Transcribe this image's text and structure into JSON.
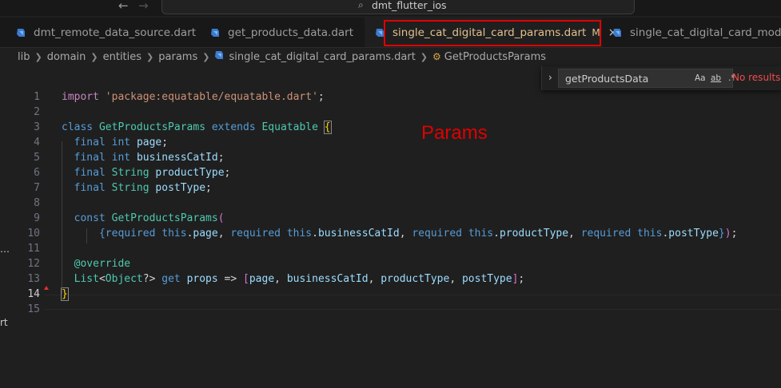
{
  "window": {
    "title": "dmt_flutter_ios"
  },
  "tabs": [
    {
      "label": "dmt_remote_data_source.dart"
    },
    {
      "label": "get_products_data.dart"
    },
    {
      "label": "single_cat_digital_card_params.dart",
      "modified": "M",
      "close": "×"
    },
    {
      "label": "single_cat_digital_card_model.d"
    }
  ],
  "breadcrumbs": {
    "parts": [
      "lib",
      "domain",
      "entities",
      "params",
      "single_cat_digital_card_params.dart"
    ],
    "symbol": "GetProductsParams"
  },
  "find": {
    "query": "getProductsData",
    "opt_case": "Aa",
    "opt_word": "ab",
    "opt_regex": ".*",
    "status": "No results"
  },
  "annotation": "Params",
  "left_fragments": [
    "…",
    "rt"
  ],
  "editor": {
    "current_line": 14,
    "lines": [
      {
        "n": "1",
        "tokens": [
          {
            "c": "kwc",
            "t": "import"
          },
          {
            "c": "plain",
            "t": " "
          },
          {
            "c": "str",
            "t": "'package:equatable/equatable.dart'"
          },
          {
            "c": "plain",
            "t": ";"
          }
        ]
      },
      {
        "n": "2",
        "tokens": []
      },
      {
        "n": "3",
        "tokens": [
          {
            "c": "kw",
            "t": "class"
          },
          {
            "c": "plain",
            "t": " "
          },
          {
            "c": "type",
            "t": "GetProductsParams"
          },
          {
            "c": "plain",
            "t": " "
          },
          {
            "c": "kw",
            "t": "extends"
          },
          {
            "c": "plain",
            "t": " "
          },
          {
            "c": "type",
            "t": "Equatable"
          },
          {
            "c": "plain",
            "t": " "
          },
          {
            "c": "b1 bracket-box",
            "t": "{"
          }
        ]
      },
      {
        "n": "4",
        "tokens": [
          {
            "c": "plain",
            "t": "  "
          },
          {
            "c": "kw",
            "t": "final"
          },
          {
            "c": "plain",
            "t": " "
          },
          {
            "c": "kw",
            "t": "int"
          },
          {
            "c": "plain",
            "t": " "
          },
          {
            "c": "var",
            "t": "page"
          },
          {
            "c": "plain",
            "t": ";"
          }
        ]
      },
      {
        "n": "5",
        "tokens": [
          {
            "c": "plain",
            "t": "  "
          },
          {
            "c": "kw",
            "t": "final"
          },
          {
            "c": "plain",
            "t": " "
          },
          {
            "c": "kw",
            "t": "int"
          },
          {
            "c": "plain",
            "t": " "
          },
          {
            "c": "var",
            "t": "businessCatId"
          },
          {
            "c": "plain",
            "t": ";"
          }
        ]
      },
      {
        "n": "6",
        "tokens": [
          {
            "c": "plain",
            "t": "  "
          },
          {
            "c": "kw",
            "t": "final"
          },
          {
            "c": "plain",
            "t": " "
          },
          {
            "c": "type",
            "t": "String"
          },
          {
            "c": "plain",
            "t": " "
          },
          {
            "c": "var",
            "t": "productType"
          },
          {
            "c": "plain",
            "t": ";"
          }
        ]
      },
      {
        "n": "7",
        "tokens": [
          {
            "c": "plain",
            "t": "  "
          },
          {
            "c": "kw",
            "t": "final"
          },
          {
            "c": "plain",
            "t": " "
          },
          {
            "c": "type",
            "t": "String"
          },
          {
            "c": "plain",
            "t": " "
          },
          {
            "c": "var",
            "t": "postType"
          },
          {
            "c": "plain",
            "t": ";"
          }
        ]
      },
      {
        "n": "8",
        "tokens": []
      },
      {
        "n": "9",
        "tokens": [
          {
            "c": "plain",
            "t": "  "
          },
          {
            "c": "kw",
            "t": "const"
          },
          {
            "c": "plain",
            "t": " "
          },
          {
            "c": "type",
            "t": "GetProductsParams"
          },
          {
            "c": "b2",
            "t": "("
          }
        ]
      },
      {
        "n": "10",
        "tokens": [
          {
            "c": "plain",
            "t": "      "
          },
          {
            "c": "kw",
            "t": "{"
          },
          {
            "c": "kw",
            "t": "required"
          },
          {
            "c": "plain",
            "t": " "
          },
          {
            "c": "kw",
            "t": "this"
          },
          {
            "c": "plain",
            "t": "."
          },
          {
            "c": "var",
            "t": "page"
          },
          {
            "c": "plain",
            "t": ", "
          },
          {
            "c": "kw",
            "t": "required"
          },
          {
            "c": "plain",
            "t": " "
          },
          {
            "c": "kw",
            "t": "this"
          },
          {
            "c": "plain",
            "t": "."
          },
          {
            "c": "var",
            "t": "businessCatId"
          },
          {
            "c": "plain",
            "t": ", "
          },
          {
            "c": "kw",
            "t": "required"
          },
          {
            "c": "plain",
            "t": " "
          },
          {
            "c": "kw",
            "t": "this"
          },
          {
            "c": "plain",
            "t": "."
          },
          {
            "c": "var",
            "t": "productType"
          },
          {
            "c": "plain",
            "t": ", "
          },
          {
            "c": "kw",
            "t": "required"
          },
          {
            "c": "plain",
            "t": " "
          },
          {
            "c": "kw",
            "t": "this"
          },
          {
            "c": "plain",
            "t": "."
          },
          {
            "c": "var",
            "t": "postType"
          },
          {
            "c": "kw",
            "t": "}"
          },
          {
            "c": "b2",
            "t": ")"
          },
          {
            "c": "plain",
            "t": ";"
          }
        ]
      },
      {
        "n": "11",
        "tokens": []
      },
      {
        "n": "12",
        "tokens": [
          {
            "c": "plain",
            "t": "  "
          },
          {
            "c": "type",
            "t": "@override"
          }
        ]
      },
      {
        "n": "13",
        "tokens": [
          {
            "c": "plain",
            "t": "  "
          },
          {
            "c": "type",
            "t": "List"
          },
          {
            "c": "plain",
            "t": "<"
          },
          {
            "c": "type",
            "t": "Object"
          },
          {
            "c": "plain",
            "t": "?> "
          },
          {
            "c": "kw",
            "t": "get"
          },
          {
            "c": "plain",
            "t": " "
          },
          {
            "c": "var",
            "t": "props"
          },
          {
            "c": "plain",
            "t": " => "
          },
          {
            "c": "b2",
            "t": "["
          },
          {
            "c": "var",
            "t": "page"
          },
          {
            "c": "plain",
            "t": ", "
          },
          {
            "c": "var",
            "t": "businessCatId"
          },
          {
            "c": "plain",
            "t": ", "
          },
          {
            "c": "var",
            "t": "productType"
          },
          {
            "c": "plain",
            "t": ", "
          },
          {
            "c": "var",
            "t": "postType"
          },
          {
            "c": "b2",
            "t": "]"
          },
          {
            "c": "plain",
            "t": ";"
          }
        ]
      },
      {
        "n": "14",
        "tokens": [
          {
            "c": "b1 bracket-box",
            "t": "}"
          }
        ]
      },
      {
        "n": "15",
        "tokens": []
      }
    ]
  }
}
